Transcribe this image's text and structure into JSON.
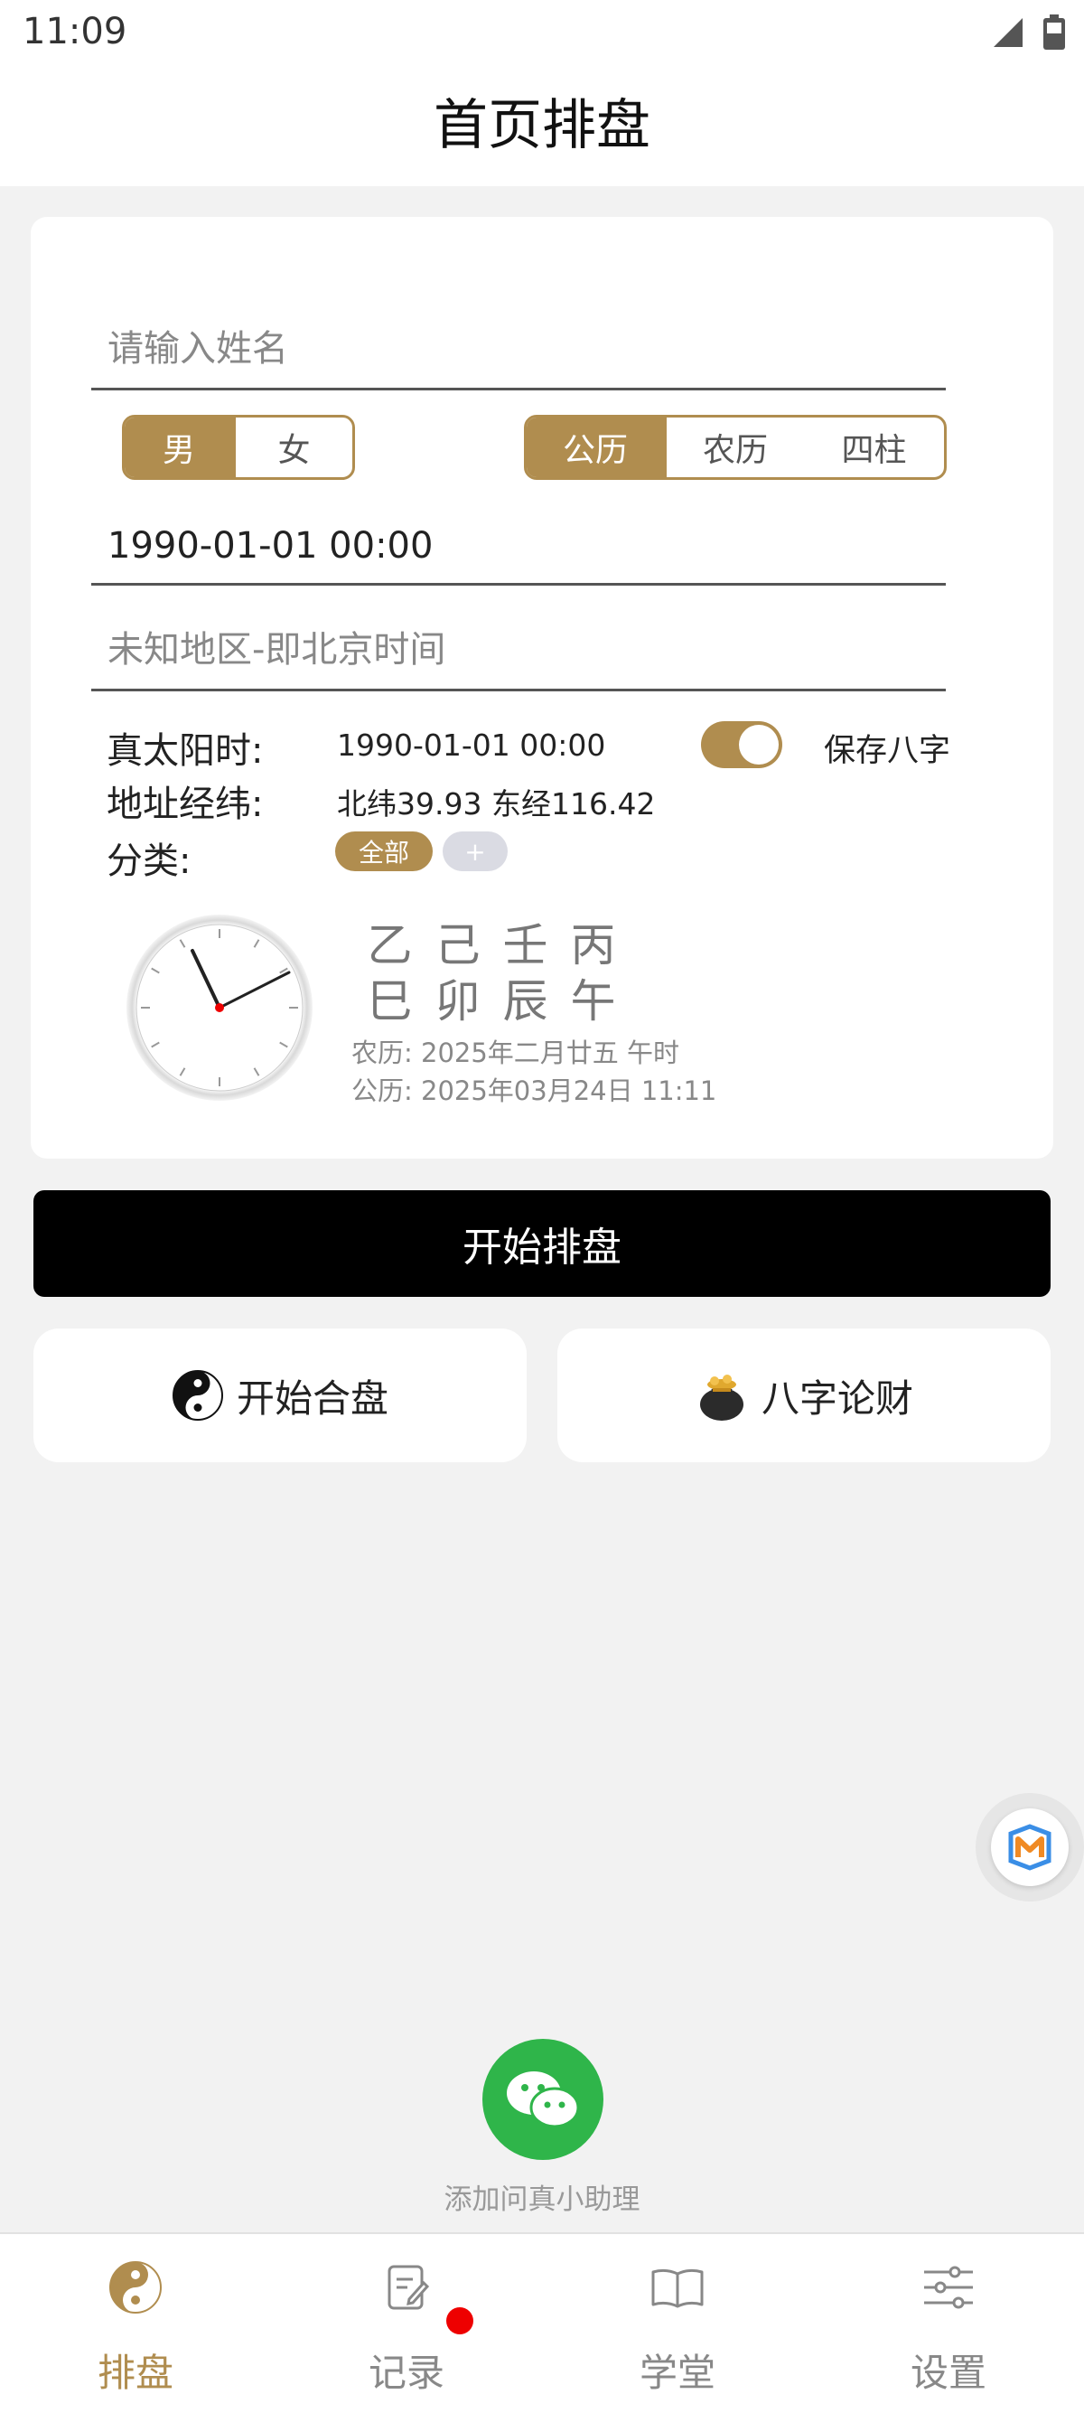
{
  "status": {
    "time": "11:09"
  },
  "header": {
    "title": "首页排盘"
  },
  "form": {
    "name_placeholder": "请输入姓名",
    "gender": {
      "options": [
        "男",
        "女"
      ],
      "selected": "男"
    },
    "calendar": {
      "options": [
        "公历",
        "农历",
        "四柱"
      ],
      "selected": "公历"
    },
    "datetime_value": "1990-01-01 00:00",
    "location_placeholder": "未知地区-即北京时间"
  },
  "info": {
    "solar_label": "真太阳时:",
    "solar_value": "1990-01-01 00:00",
    "address_label": "地址经纬:",
    "address_value": "北纬39.93 东经116.42",
    "category_label": "分类:",
    "category_all": "全部",
    "category_add": "+",
    "save_label": "保存八字",
    "save_enabled": true
  },
  "bazi": {
    "stems": [
      "乙",
      "己",
      "壬",
      "丙"
    ],
    "branches": [
      "巳",
      "卯",
      "辰",
      "午"
    ],
    "lunar_line": "农历: 2025年二月廿五 午时",
    "solar_line": "公历: 2025年03月24日 11:11",
    "clock_time": "11:11"
  },
  "actions": {
    "start_label": "开始排盘",
    "match_label": "开始合盘",
    "wealth_label": "八字论财"
  },
  "assistant": {
    "label": "添加问真小助理"
  },
  "tabs": [
    {
      "label": "排盘",
      "icon": "yin-yang-icon",
      "active": true
    },
    {
      "label": "记录",
      "icon": "notes-icon",
      "active": false,
      "badge": true
    },
    {
      "label": "学堂",
      "icon": "book-icon",
      "active": false
    },
    {
      "label": "设置",
      "icon": "sliders-icon",
      "active": false
    }
  ],
  "colors": {
    "accent": "#b08d4f",
    "primary_button": "#000000",
    "wechat": "#2fb54a",
    "badge": "#ee0000"
  }
}
